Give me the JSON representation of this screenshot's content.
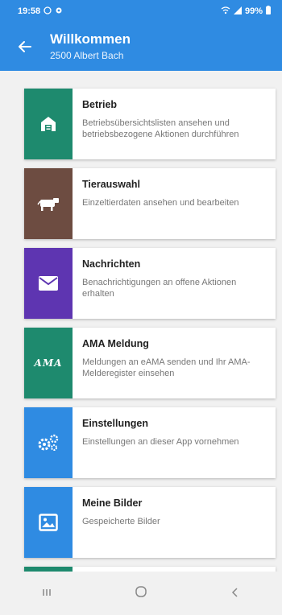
{
  "status": {
    "time": "19:58",
    "battery": "99%"
  },
  "appbar": {
    "title": "Willkommen",
    "subtitle": "2500 Albert Bach"
  },
  "cards": [
    {
      "title": "Betrieb",
      "desc": "Betriebsübersichtslisten ansehen und betriebsbezogene Aktionen durchführen",
      "icon": "barn-icon",
      "color": "#1e8a6e"
    },
    {
      "title": "Tierauswahl",
      "desc": "Einzeltierdaten ansehen und bearbeiten",
      "icon": "cow-icon",
      "color": "#6d4c41"
    },
    {
      "title": "Nachrichten",
      "desc": "Benachrichtigungen an offene Aktionen erhalten",
      "icon": "mail-icon",
      "color": "#5e35b1"
    },
    {
      "title": "AMA Meldung",
      "desc": "Meldungen an eAMA senden und Ihr AMA-Melderegister einsehen",
      "icon": "ama-logo-icon",
      "color": "#1e8a6e",
      "logo_text": "AMA"
    },
    {
      "title": "Einstellungen",
      "desc": "Einstellungen an dieser App vornehmen",
      "icon": "gears-icon",
      "color": "#2f8be2"
    },
    {
      "title": "Meine Bilder",
      "desc": "Gespeicherte Bilder",
      "icon": "image-icon",
      "color": "#2f8be2"
    }
  ]
}
